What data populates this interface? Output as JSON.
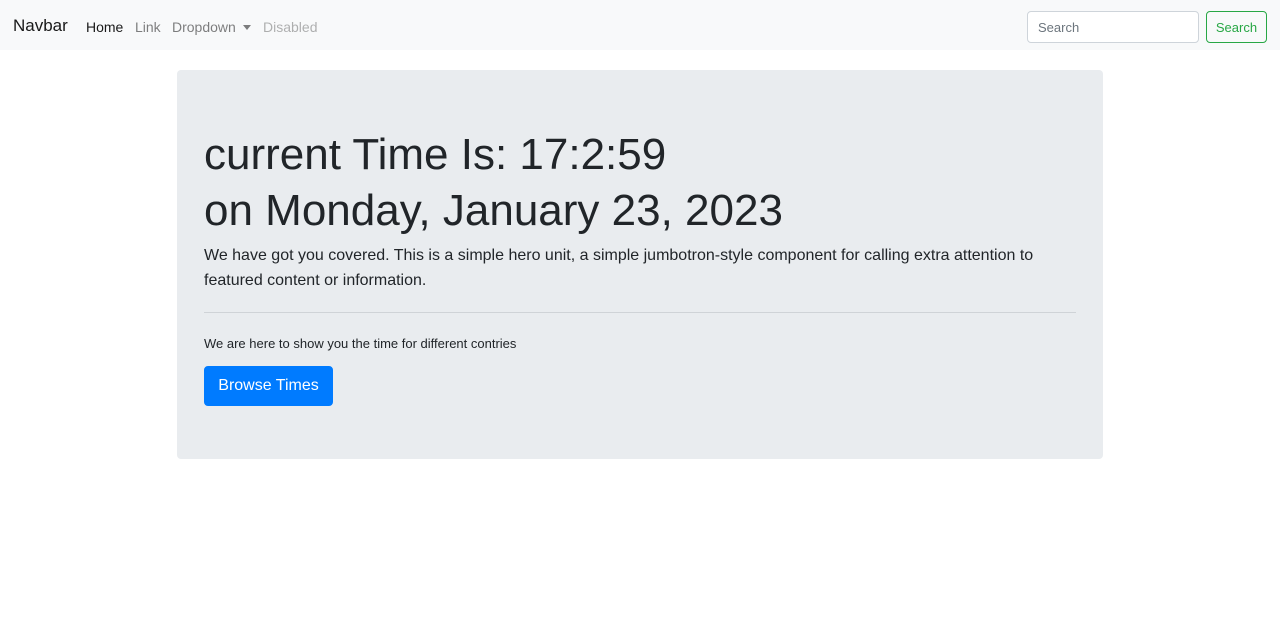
{
  "navbar": {
    "brand": "Navbar",
    "links": {
      "home": "Home",
      "link": "Link",
      "dropdown": "Dropdown",
      "disabled": "Disabled"
    },
    "search": {
      "placeholder": "Search",
      "button_label": "Search"
    }
  },
  "jumbotron": {
    "heading_line_1": "current Time Is: 17:2:59",
    "heading_line_2": "on Monday, January 23, 2023",
    "lead": "We have got you covered. This is a simple hero unit, a simple jumbotron-style component for calling extra attention to featured content or information.",
    "body": "We are here to show you the time for different contries",
    "button_label": "Browse Times"
  },
  "colors": {
    "primary": "#007bff",
    "success": "#28a745",
    "jumbotron_bg": "#e9ecef",
    "navbar_bg": "#f8f9fa"
  },
  "icons": {
    "dropdown": "caret-down-icon"
  }
}
